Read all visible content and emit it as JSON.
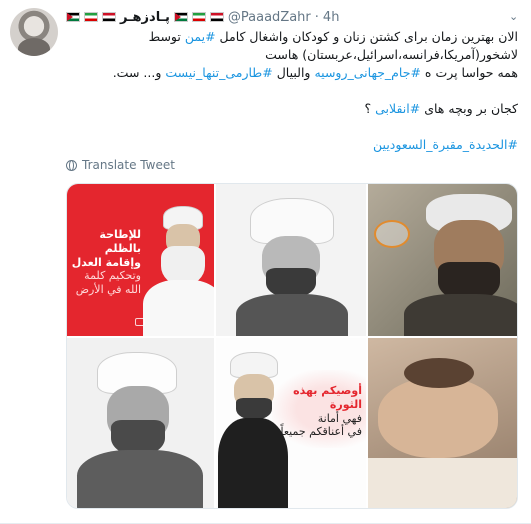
{
  "author": {
    "display_name": "پـادزهـر",
    "handle": "@PaaadZahr",
    "separator": "·",
    "time": "4h",
    "flags": [
      "ps",
      "ir",
      "ye",
      "ps",
      "ir",
      "ye"
    ]
  },
  "tweet": {
    "line1": "الان بهترین زمان برای کشتن زنان و کودکان واشغال کامل",
    "line1_hashtag": "#یمن",
    "line1_end": "توسط",
    "line2": "لاشخور(آمریکا،فرانسه،اسرائیل،عربستان) هاست",
    "line3_start": "همه حواسا پرت ه",
    "line3_hashtag1": "#جام_جهانی_روسیه",
    "line3_mid": "والبیال",
    "line3_hashtag2": "#طارمی_تنها_نیست",
    "line3_end": "و... ست.",
    "line4_start": "کجان بر وبچه های",
    "line4_hashtag": "#انقلابی",
    "line4_end": "؟",
    "line5_hashtag": "#الحديدة_مقبرة_السعوديين"
  },
  "translate_label": "Translate Tweet",
  "posters": {
    "p1_line1": "للإطاحة بالظلم",
    "p1_line2": "وإقامة العدل",
    "p1_line3": "وتحكيم كلمة",
    "p1_line4": "الله في الأرض",
    "p5_line1": "أوصيكم بهذه",
    "p5_line2": "الثورة",
    "p5_line3": "فهي أمانة",
    "p5_line4": "في أعناقكم جميعاً"
  },
  "colors": {
    "hashtag": "#1b95e0",
    "text": "#14171a",
    "muted": "#657786",
    "poster_red": "#e4262e"
  }
}
